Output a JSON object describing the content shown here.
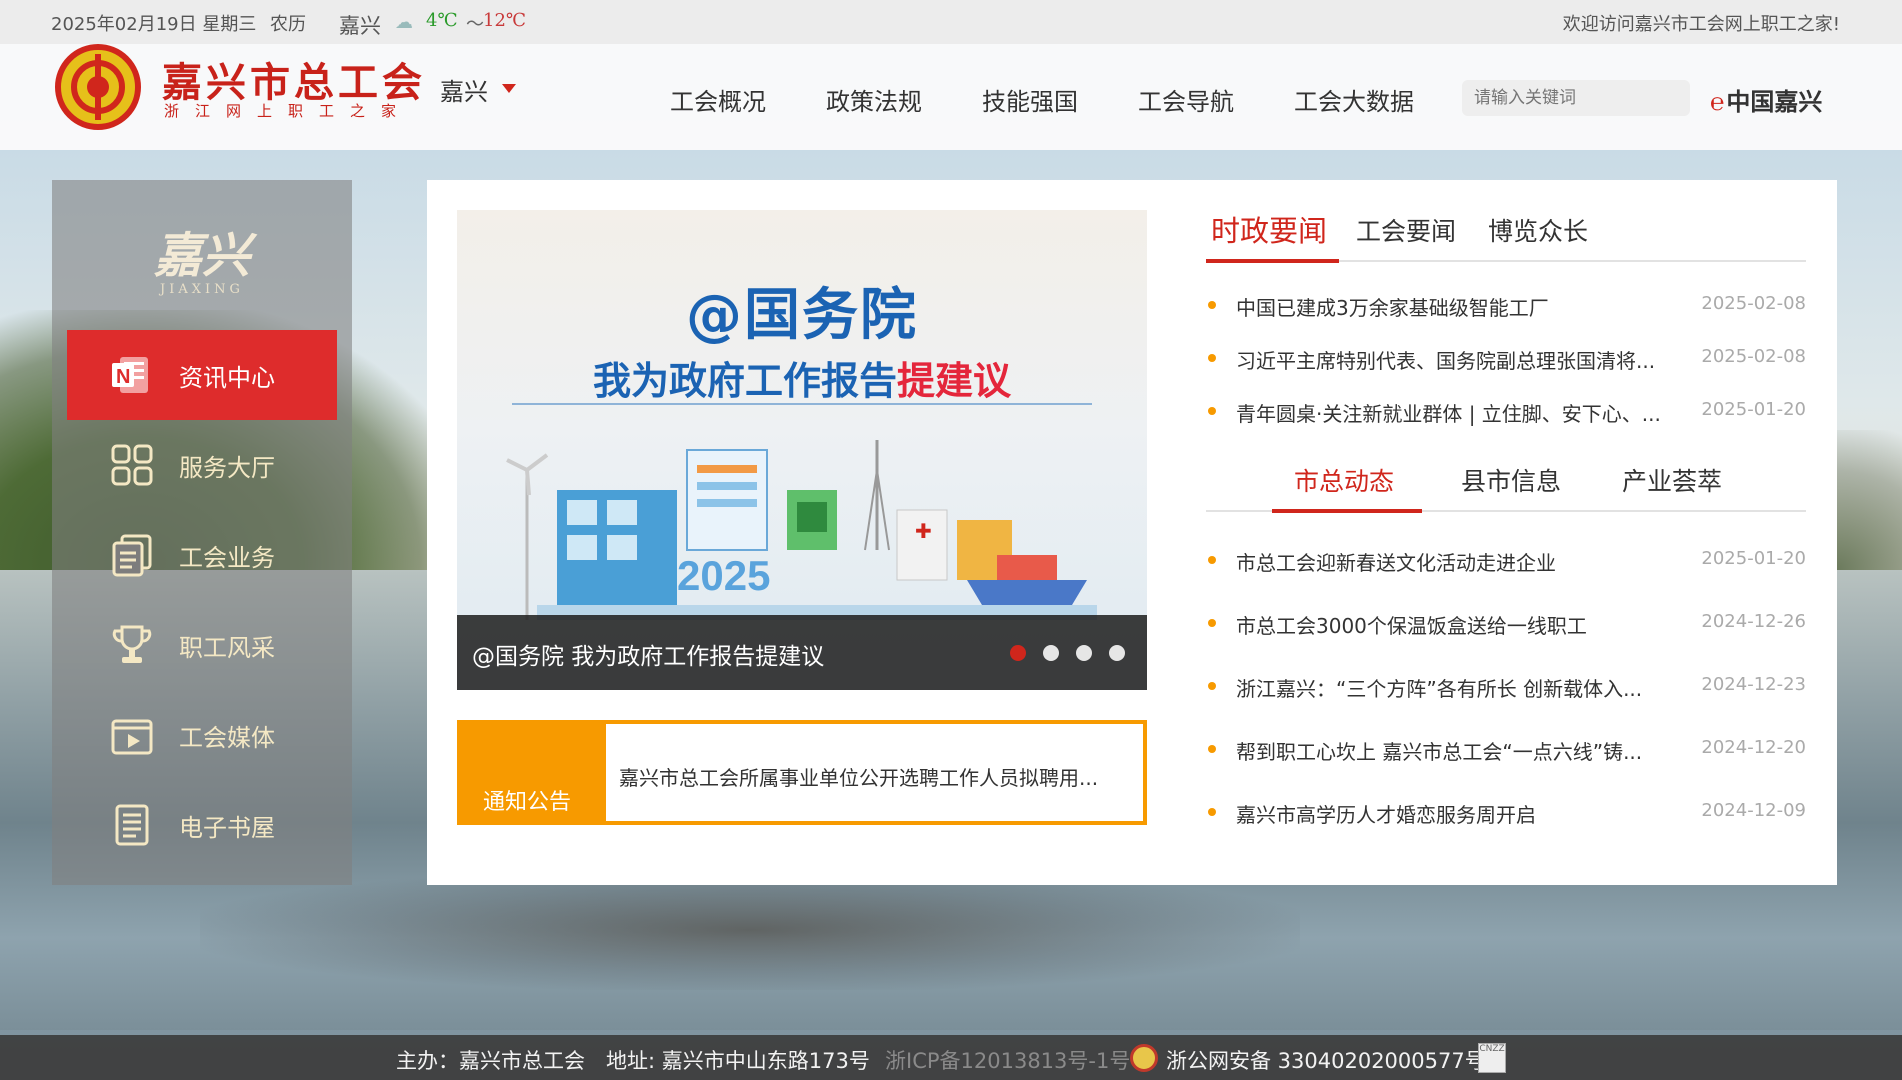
{
  "topbar": {
    "date": "2025年02月19日 星期三",
    "lunar": "农历",
    "city": "嘉兴",
    "weather_icon": "cloudy-icon",
    "temp_low": "4℃",
    "tilde": "～",
    "temp_high": "12℃",
    "welcome": "欢迎访问嘉兴市工会网上职工之家!"
  },
  "header": {
    "logo_title": "嘉兴市总工会",
    "logo_subtitle": "浙江网上职工之家",
    "region": "嘉兴",
    "nav": [
      "工会概况",
      "政策法规",
      "技能强国",
      "工会导航",
      "工会大数据"
    ],
    "search_placeholder": "请输入关键词",
    "partner_logo": "中国嘉兴"
  },
  "sidebar": {
    "brand": "嘉兴",
    "brand_sub": "JIAXING",
    "items": [
      {
        "label": "资讯中心",
        "icon": "onenote-icon",
        "active": true
      },
      {
        "label": "服务大厅",
        "icon": "grid-icon",
        "active": false
      },
      {
        "label": "工会业务",
        "icon": "documents-icon",
        "active": false
      },
      {
        "label": "职工风采",
        "icon": "trophy-icon",
        "active": false
      },
      {
        "label": "工会媒体",
        "icon": "video-icon",
        "active": false
      },
      {
        "label": "电子书屋",
        "icon": "book-icon",
        "active": false
      }
    ]
  },
  "slider": {
    "headline": "@国务院",
    "subline_a": "我为政府工作报告",
    "subline_b": "提建议",
    "art_year": "2025",
    "caption": "@国务院 我为政府工作报告提建议",
    "dot_count": 4,
    "active_dot": 0
  },
  "notice": {
    "tag": "通知公告",
    "text": "嘉兴市总工会所属事业单位公开选聘工作人员拟聘用..."
  },
  "news_tabs_1": {
    "tabs": [
      "时政要闻",
      "工会要闻",
      "博览众长"
    ],
    "active": 0,
    "items": [
      {
        "title": "中国已建成3万余家基础级智能工厂",
        "date": "2025-02-08"
      },
      {
        "title": "习近平主席特别代表、国务院副总理张国清将...",
        "date": "2025-02-08"
      },
      {
        "title": "青年圆桌·关注新就业群体 | 立住脚、安下心、...",
        "date": "2025-01-20"
      }
    ]
  },
  "news_tabs_2": {
    "tabs": [
      "市总动态",
      "县市信息",
      "产业荟萃"
    ],
    "active": 0,
    "items": [
      {
        "title": "市总工会迎新春送文化活动走进企业",
        "date": "2025-01-20"
      },
      {
        "title": "市总工会3000个保温饭盒送给一线职工",
        "date": "2024-12-26"
      },
      {
        "title": "浙江嘉兴：“三个方阵”各有所长 创新载体入...",
        "date": "2024-12-23"
      },
      {
        "title": "帮到职工心坎上 嘉兴市总工会“一点六线”铸...",
        "date": "2024-12-20"
      },
      {
        "title": "嘉兴市高学历人才婚恋服务周开启",
        "date": "2024-12-09"
      }
    ]
  },
  "footer": {
    "host": "主办：嘉兴市总工会",
    "address": "地址: 嘉兴市中山东路173号",
    "icp": "浙ICP备12013813号-1号",
    "police": "浙公网安备 33040202000577号",
    "badge_icon": "cnzz-badge-icon",
    "badge_text": "CNZZ"
  },
  "colors": {
    "brand_red": "#d0261c",
    "accent_orange": "#f79a00",
    "sidebar_active": "#de2c2c",
    "link_blue": "#1b63b3"
  }
}
